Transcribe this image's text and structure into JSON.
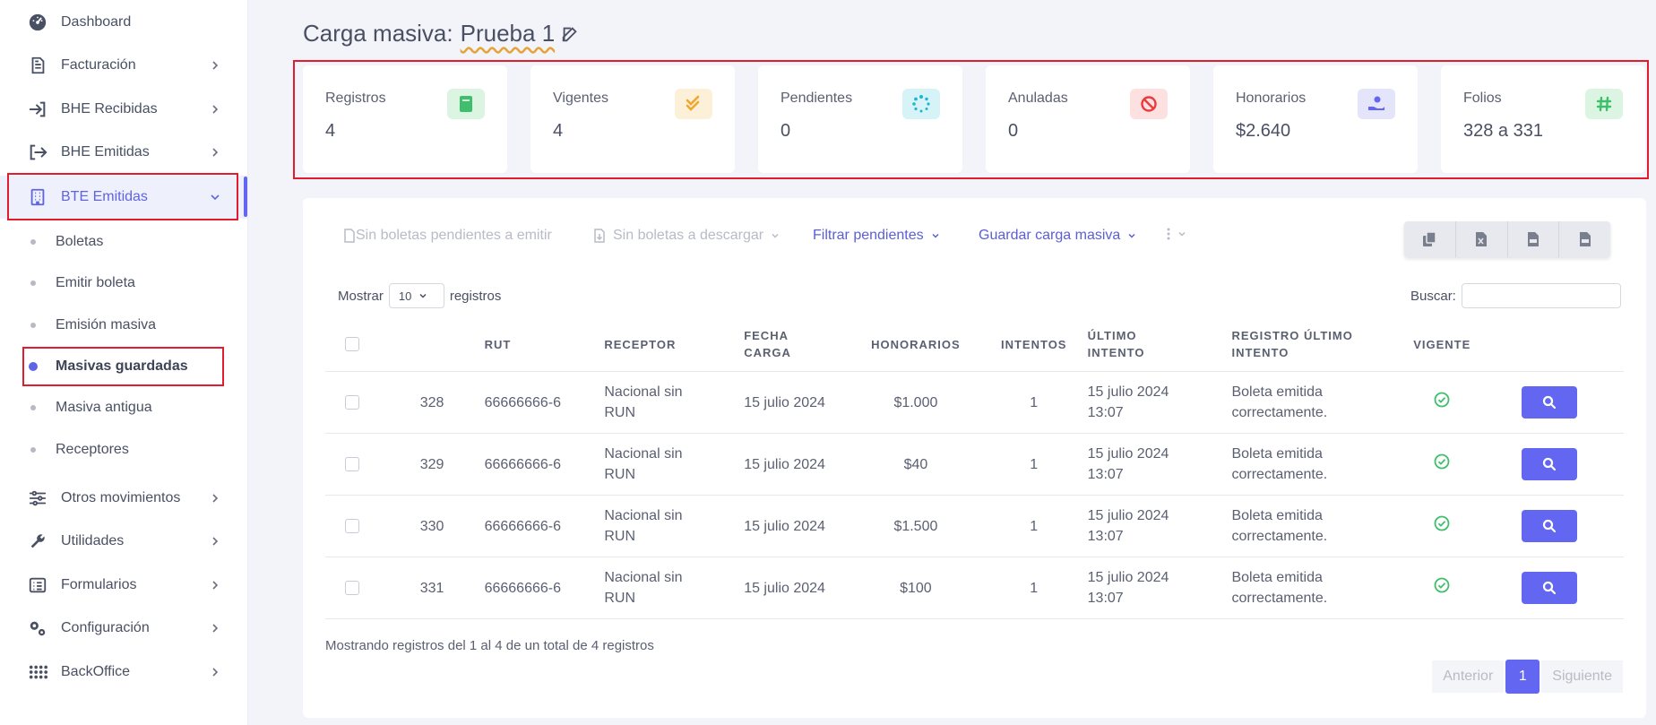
{
  "sidebar": {
    "items": [
      {
        "label": "Dashboard",
        "icon": "dashboard-gauge-icon"
      },
      {
        "label": "Facturación",
        "icon": "invoice-document-icon"
      },
      {
        "label": "BHE Recibidas",
        "icon": "login-arrow-icon"
      },
      {
        "label": "BHE Emitidas",
        "icon": "logout-arrow-icon"
      },
      {
        "label": "BTE Emitidas",
        "icon": "building-icon"
      },
      {
        "label": "Otros movimientos",
        "icon": "sliders-icon"
      },
      {
        "label": "Utilidades",
        "icon": "wrench-icon"
      },
      {
        "label": "Formularios",
        "icon": "list-form-icon"
      },
      {
        "label": "Configuración",
        "icon": "gears-icon"
      },
      {
        "label": "BackOffice",
        "icon": "grid-dots-icon"
      }
    ],
    "subitems": [
      {
        "label": "Boletas"
      },
      {
        "label": "Emitir boleta"
      },
      {
        "label": "Emisión masiva"
      },
      {
        "label": "Masivas guardadas"
      },
      {
        "label": "Masiva antigua"
      },
      {
        "label": "Receptores"
      }
    ]
  },
  "header": {
    "title_prefix": "Carga masiva:",
    "title_name": "Prueba 1"
  },
  "stats": [
    {
      "label": "Registros",
      "value": "4",
      "icon": "book-icon",
      "bg": "#dcf5e3",
      "fg": "#3fbf6c"
    },
    {
      "label": "Vigentes",
      "value": "4",
      "icon": "double-check-icon",
      "bg": "#fdf0d8",
      "fg": "#f1a62f"
    },
    {
      "label": "Pendientes",
      "value": "0",
      "icon": "spinner-icon",
      "bg": "#d6f3f8",
      "fg": "#22b4d1"
    },
    {
      "label": "Anuladas",
      "value": "0",
      "icon": "ban-icon",
      "bg": "#fde1e1",
      "fg": "#ea3b3b"
    },
    {
      "label": "Honorarios",
      "value": "$2.640",
      "icon": "hand-coin-icon",
      "bg": "#e4e4fb",
      "fg": "#6366f1"
    },
    {
      "label": "Folios",
      "value": "328 a 331",
      "icon": "hashtag-icon",
      "bg": "#dcf5e3",
      "fg": "#3fbf6c"
    }
  ],
  "toolbar": {
    "no_pending": "Sin boletas pendientes a emitir",
    "no_download": "Sin boletas a descargar",
    "filter": "Filtrar pendientes",
    "save": "Guardar carga masiva"
  },
  "table_controls": {
    "show_label": "Mostrar",
    "length_value": "10",
    "records_label": "registros",
    "search_label": "Buscar:"
  },
  "table": {
    "columns": [
      "RUT",
      "RECEPTOR",
      "FECHA CARGA",
      "HONORARIOS",
      "INTENTOS",
      "ÚLTIMO INTENTO",
      "REGISTRO ÚLTIMO INTENTO",
      "VIGENTE"
    ],
    "rows": [
      {
        "folio": "328",
        "rut": "66666666-6",
        "receptor": "Nacional sin RUN",
        "fecha": "15 julio 2024",
        "honorarios": "$1.000",
        "intentos": "1",
        "ultimo": "15 julio 2024 13:07",
        "registro": "Boleta emitida correctamente."
      },
      {
        "folio": "329",
        "rut": "66666666-6",
        "receptor": "Nacional sin RUN",
        "fecha": "15 julio 2024",
        "honorarios": "$40",
        "intentos": "1",
        "ultimo": "15 julio 2024 13:07",
        "registro": "Boleta emitida correctamente."
      },
      {
        "folio": "330",
        "rut": "66666666-6",
        "receptor": "Nacional sin RUN",
        "fecha": "15 julio 2024",
        "honorarios": "$1.500",
        "intentos": "1",
        "ultimo": "15 julio 2024 13:07",
        "registro": "Boleta emitida correctamente."
      },
      {
        "folio": "331",
        "rut": "66666666-6",
        "receptor": "Nacional sin RUN",
        "fecha": "15 julio 2024",
        "honorarios": "$100",
        "intentos": "1",
        "ultimo": "15 julio 2024 13:07",
        "registro": "Boleta emitida correctamente."
      }
    ]
  },
  "footer": {
    "info": "Mostrando registros del 1 al 4 de un total de 4 registros",
    "prev": "Anterior",
    "page": "1",
    "next": "Siguiente"
  },
  "colors": {
    "accent": "#6366f1",
    "highlight_border": "#e21c2c",
    "success": "#3fbf6c"
  }
}
